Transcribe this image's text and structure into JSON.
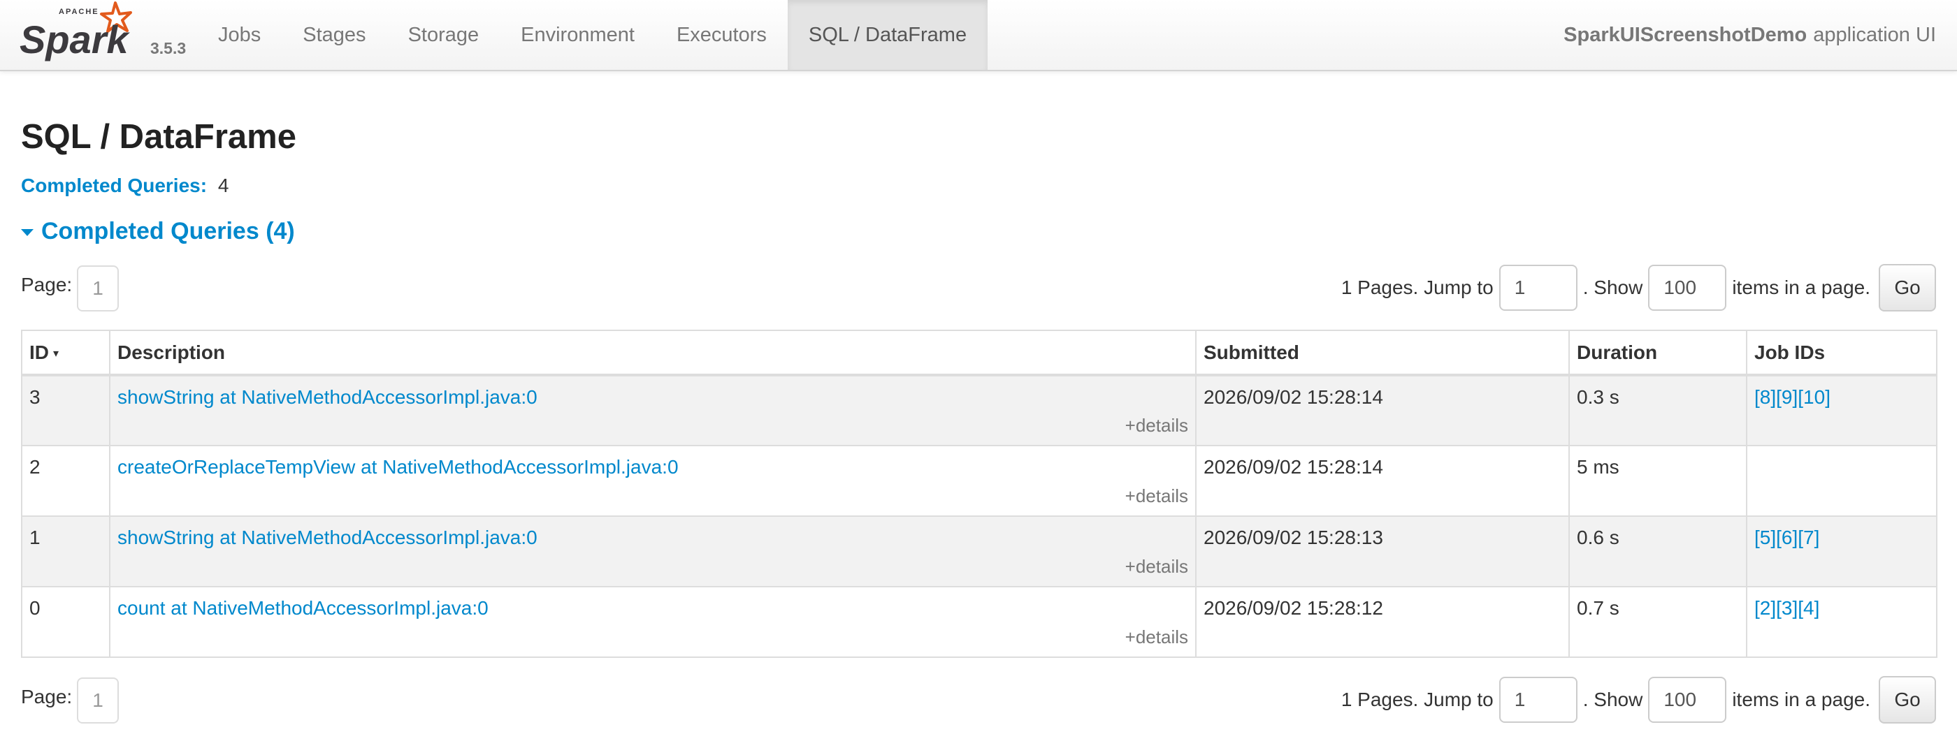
{
  "navbar": {
    "brand_apache": "APACHE",
    "brand_name": "Spark",
    "version": "3.5.3",
    "tabs": [
      {
        "label": "Jobs",
        "active": false
      },
      {
        "label": "Stages",
        "active": false
      },
      {
        "label": "Storage",
        "active": false
      },
      {
        "label": "Environment",
        "active": false
      },
      {
        "label": "Executors",
        "active": false
      },
      {
        "label": "SQL / DataFrame",
        "active": true
      }
    ],
    "app_name": "SparkUIScreenshotDemo",
    "app_suffix": "application UI"
  },
  "page": {
    "title": "SQL / DataFrame",
    "summary_label": "Completed Queries:",
    "summary_value": "4",
    "section_title": "Completed Queries (4)"
  },
  "paging": {
    "page_label": "Page:",
    "current_page": "1",
    "pages_text": "1 Pages. Jump to",
    "jump_value": "1",
    "show_text": ". Show",
    "show_value": "100",
    "items_text": "items in a page.",
    "go_label": "Go"
  },
  "table": {
    "columns": [
      "ID",
      "Description",
      "Submitted",
      "Duration",
      "Job IDs"
    ],
    "sort_indicator": "▾",
    "details_label": "+details",
    "rows": [
      {
        "id": "3",
        "description": "showString at NativeMethodAccessorImpl.java:0",
        "submitted": "2026/09/02 15:28:14",
        "duration": "0.3 s",
        "job_ids": [
          "[8]",
          "[9]",
          "[10]"
        ]
      },
      {
        "id": "2",
        "description": "createOrReplaceTempView at NativeMethodAccessorImpl.java:0",
        "submitted": "2026/09/02 15:28:14",
        "duration": "5 ms",
        "job_ids": []
      },
      {
        "id": "1",
        "description": "showString at NativeMethodAccessorImpl.java:0",
        "submitted": "2026/09/02 15:28:13",
        "duration": "0.6 s",
        "job_ids": [
          "[5]",
          "[6]",
          "[7]"
        ]
      },
      {
        "id": "0",
        "description": "count at NativeMethodAccessorImpl.java:0",
        "submitted": "2026/09/02 15:28:12",
        "duration": "0.7 s",
        "job_ids": [
          "[2]",
          "[3]",
          "[4]"
        ]
      }
    ]
  },
  "colors": {
    "link": "#0088cc",
    "spark_orange": "#e25a1c",
    "spark_text": "#3c3a3e"
  }
}
